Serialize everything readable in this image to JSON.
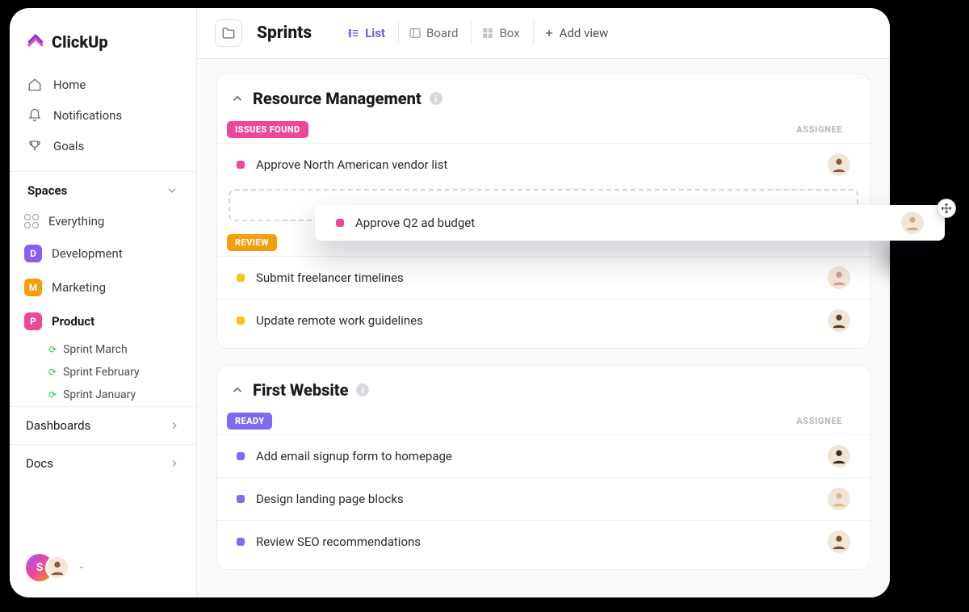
{
  "brand": {
    "name": "ClickUp"
  },
  "nav": {
    "home": "Home",
    "notifications": "Notifications",
    "goals": "Goals"
  },
  "spaces_header": "Spaces",
  "everything_label": "Everything",
  "spaces": [
    {
      "letter": "D",
      "label": "Development",
      "color": "#8b5cf6"
    },
    {
      "letter": "M",
      "label": "Marketing",
      "color": "#f59e0b"
    },
    {
      "letter": "P",
      "label": "Product",
      "color": "#ec4899"
    }
  ],
  "sprints": [
    {
      "label": "Sprint  March"
    },
    {
      "label": "Sprint  February"
    },
    {
      "label": "Sprint January"
    }
  ],
  "foot": {
    "dashboards": "Dashboards",
    "docs": "Docs"
  },
  "user_initial": "S",
  "page": {
    "title": "Sprints",
    "views": {
      "list": "List",
      "board": "Board",
      "box": "Box",
      "add": "Add view"
    }
  },
  "columns": {
    "assignee": "ASSIGNEE"
  },
  "lists": [
    {
      "title": "Resource Management",
      "groups": [
        {
          "status_label": "ISSUES FOUND",
          "status_color": "#ec4899",
          "show_assignee_header": true,
          "tasks": [
            {
              "name": "Approve North American vendor list",
              "sq": "#ec4899"
            }
          ],
          "has_dropzone": true
        },
        {
          "status_label": "REVIEW",
          "status_color": "#f59e0b",
          "show_assignee_header": false,
          "tasks": [
            {
              "name": "Submit freelancer timelines",
              "sq": "#f5c518"
            },
            {
              "name": "Update remote work guidelines",
              "sq": "#f5c518"
            }
          ],
          "has_dropzone": false
        }
      ]
    },
    {
      "title": "First Website",
      "groups": [
        {
          "status_label": "READY",
          "status_color": "#7c6cf0",
          "show_assignee_header": true,
          "tasks": [
            {
              "name": "Add email signup form to homepage",
              "sq": "#7c6cf0"
            },
            {
              "name": "Design landing page blocks",
              "sq": "#7c6cf0"
            },
            {
              "name": "Review SEO recommendations",
              "sq": "#7c6cf0"
            }
          ],
          "has_dropzone": false
        }
      ]
    }
  ],
  "floating_task": {
    "name": "Approve Q2 ad budget",
    "sq": "#ec4899"
  }
}
